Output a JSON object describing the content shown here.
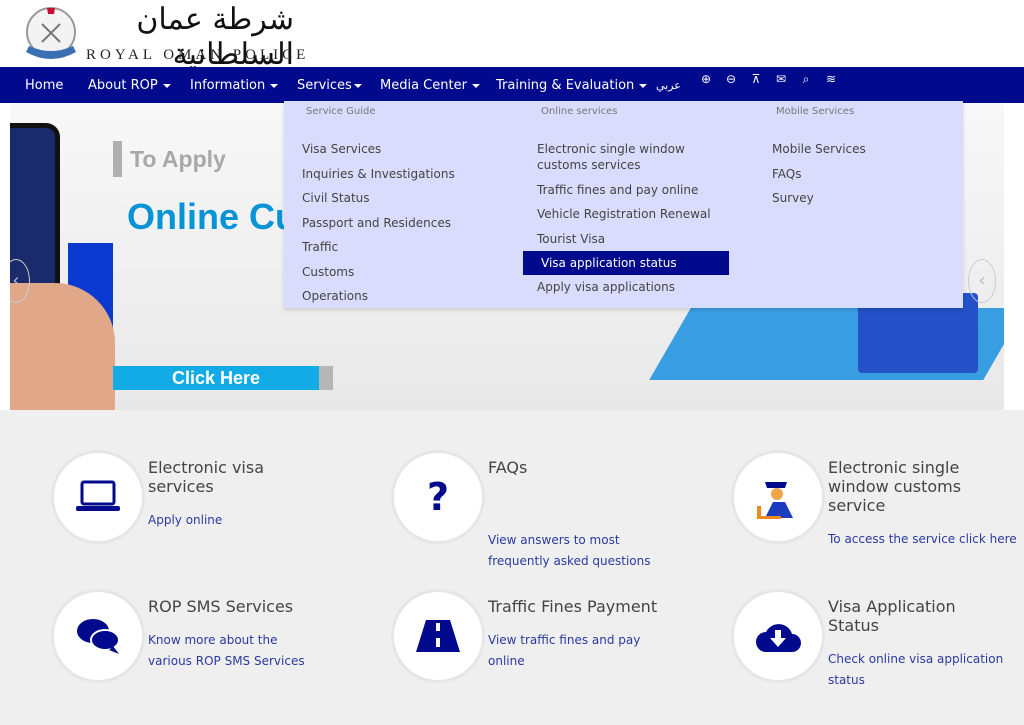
{
  "header": {
    "logo_arabic": "شرطة عمان السلطانية",
    "logo_english": "ROYAL OMAN POLICE"
  },
  "nav": {
    "items": [
      {
        "label": "Home"
      },
      {
        "label": "About ROP"
      },
      {
        "label": "Information"
      },
      {
        "label": "Services"
      },
      {
        "label": "Media Center"
      },
      {
        "label": "Training & Evaluation"
      }
    ],
    "arabic_label": "عربي",
    "icons": [
      "zoom-in-icon",
      "zoom-out-icon",
      "sitemap-icon",
      "envelope-icon",
      "search-icon",
      "rss-icon"
    ]
  },
  "banner": {
    "heading": "To Apply",
    "title": "Online Cu",
    "button": "Click Here"
  },
  "dropdown": {
    "columns": [
      {
        "header": "Service Guide",
        "items": [
          "Visa Services",
          "Inquiries & Investigations",
          "Civil Status",
          "Passport and Residences",
          "Traffic",
          "Customs",
          "Operations"
        ]
      },
      {
        "header": "Online services",
        "items": [
          "Electronic single window customs services",
          "Traffic fines and pay online",
          "Vehicle Registration Renewal",
          "Tourist Visa",
          "Visa application status",
          "Apply visa applications"
        ],
        "active": "Visa application status"
      },
      {
        "header": "Mobile Services",
        "items": [
          "Mobile Services",
          "FAQs",
          "Survey"
        ]
      }
    ]
  },
  "cards": [
    {
      "title": "Electronic visa services",
      "link": "Apply online",
      "icon": "laptop-icon"
    },
    {
      "title": "FAQs",
      "link": "View answers to most frequently asked questions",
      "icon": "question-icon"
    },
    {
      "title": "Electronic single window customs service",
      "link": "To access the service click here",
      "icon": "customs-officer-icon"
    },
    {
      "title": "ROP SMS Services",
      "link": "Know more about the various ROP SMS Services",
      "icon": "chat-bubbles-icon"
    },
    {
      "title": "Traffic Fines Payment",
      "link": "View traffic fines and pay online",
      "icon": "road-icon"
    },
    {
      "title": "Visa Application Status",
      "link": "Check online visa application status",
      "icon": "cloud-download-icon"
    }
  ],
  "colors": {
    "nav": "#010a8c",
    "dropdown": "#d9dcfc",
    "accent": "#13abe6"
  }
}
